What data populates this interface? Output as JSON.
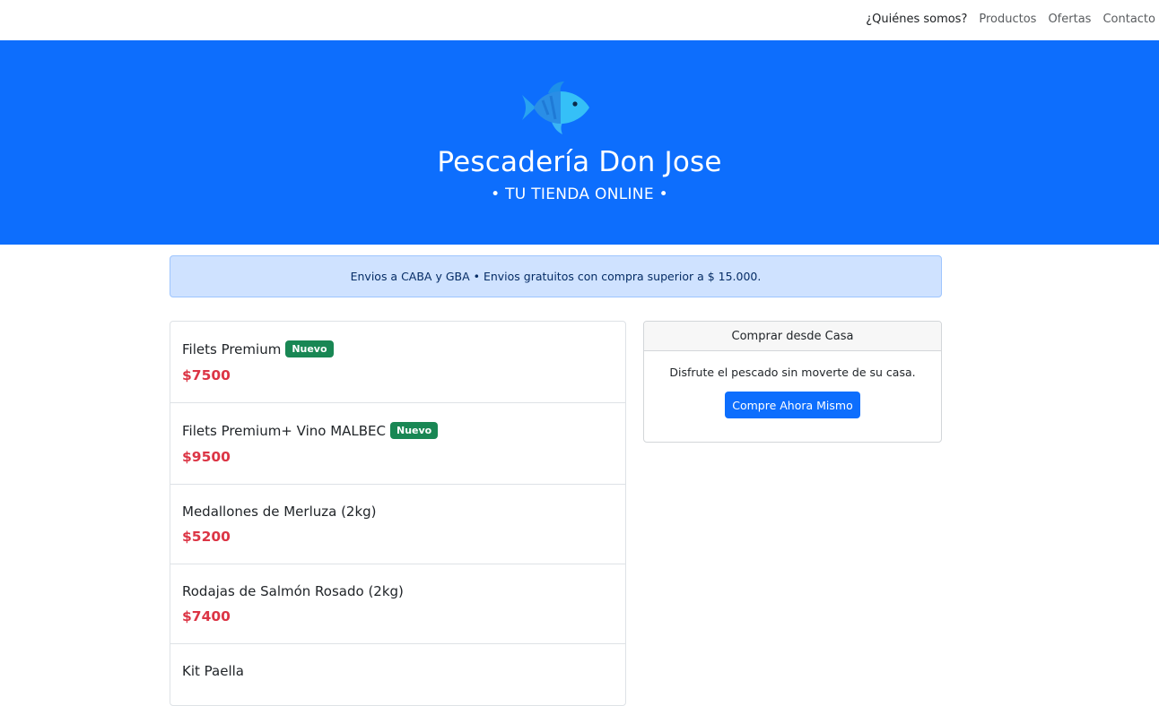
{
  "nav": {
    "items": [
      {
        "label": "¿Quiénes somos?"
      },
      {
        "label": "Productos"
      },
      {
        "label": "Ofertas"
      },
      {
        "label": "Contacto"
      }
    ]
  },
  "hero": {
    "logo_icon": "fish-icon",
    "title": "Pescadería Don Jose",
    "subtitle": "• TU TIENDA ONLINE •",
    "background": "#0d6efd"
  },
  "alert": {
    "text": "Envios a CABA y GBA • Envios gratuitos con compra superior a $ 15.000."
  },
  "products": [
    {
      "name": "Filets Premium",
      "badge": "Nuevo",
      "price": "$7500"
    },
    {
      "name": "Filets Premium+ Vino MALBEC",
      "badge": "Nuevo",
      "price": "$9500"
    },
    {
      "name": "Medallones de Merluza (2kg)",
      "badge": "",
      "price": "$5200"
    },
    {
      "name": "Rodajas de Salmón Rosado (2kg)",
      "badge": "",
      "price": "$7400"
    },
    {
      "name": "Kit Paella",
      "badge": "",
      "price": ""
    }
  ],
  "side_card": {
    "header": "Comprar desde Casa",
    "text": "Disfrute el pescado sin moverte de su casa.",
    "button_label": "Compre Ahora Mismo"
  },
  "colors": {
    "primary": "#0d6efd",
    "price": "#dc3545",
    "badge": "#198754"
  }
}
